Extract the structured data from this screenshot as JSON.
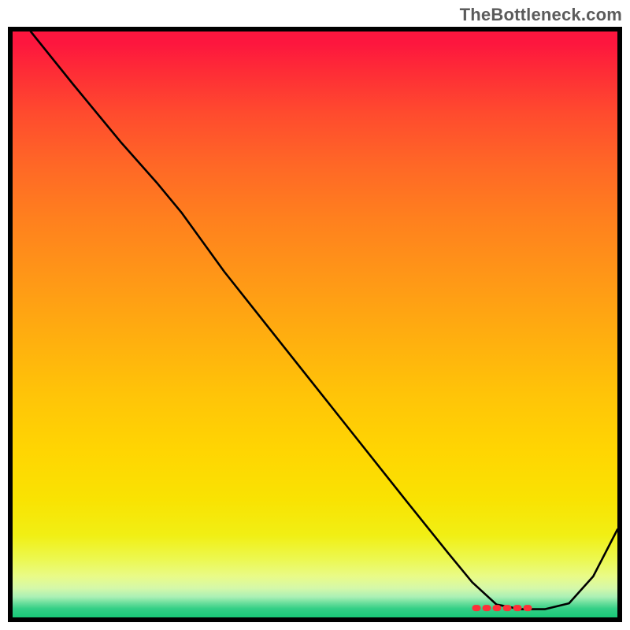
{
  "attribution": "TheBottleneck.com",
  "colors": {
    "marker": "#fe2f37"
  },
  "chart_data": {
    "type": "line",
    "title": "",
    "xlabel": "",
    "ylabel": "",
    "xlim": [
      0,
      100
    ],
    "ylim": [
      0,
      100
    ],
    "curve": {
      "x": [
        3,
        10,
        18,
        24,
        28,
        35,
        45,
        55,
        65,
        72,
        76,
        80,
        84,
        88,
        92,
        96,
        100
      ],
      "y": [
        100,
        91,
        81,
        74,
        69,
        59,
        46,
        33,
        20,
        11,
        6,
        2.2,
        1.4,
        1.4,
        2.4,
        7,
        15
      ]
    },
    "marker_strip": {
      "x": [
        76.5,
        86.5
      ],
      "y": [
        1.6,
        1.6
      ]
    }
  }
}
